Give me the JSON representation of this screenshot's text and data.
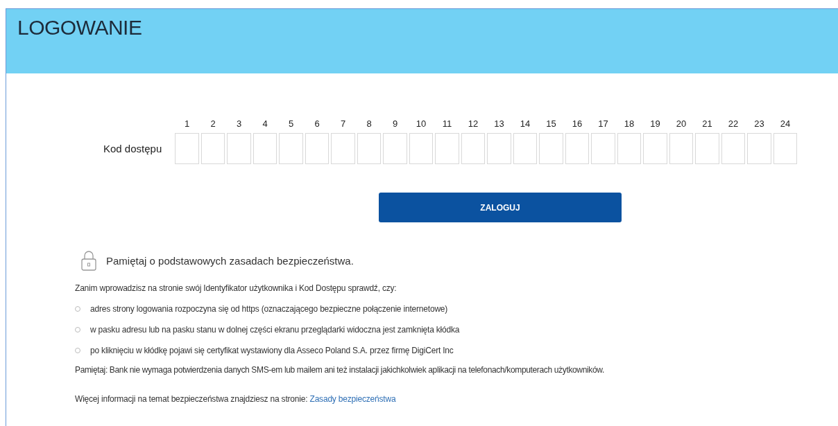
{
  "header": {
    "title": "LOGOWANIE"
  },
  "access_code": {
    "label": "Kod dostępu",
    "positions": [
      "1",
      "2",
      "3",
      "4",
      "5",
      "6",
      "7",
      "8",
      "9",
      "10",
      "11",
      "12",
      "13",
      "14",
      "15",
      "16",
      "17",
      "18",
      "19",
      "20",
      "21",
      "22",
      "23",
      "24"
    ]
  },
  "login_button": "ZALOGUJ",
  "security": {
    "heading": "Pamiętaj o podstawowych zasadach bezpieczeństwa.",
    "intro": "Zanim wprowadzisz na stronie swój Identyfikator użytkownika i Kod Dostępu sprawdź, czy:",
    "checks": [
      "adres strony logowania rozpoczyna się od https (oznaczającego bezpieczne połączenie internetowe)",
      "w pasku adresu lub na pasku stanu w dolnej części ekranu przeglądarki widoczna jest zamknięta kłódka",
      "po kliknięciu w kłódkę pojawi się certyfikat wystawiony dla Asseco Poland S.A. przez firmę DigiCert Inc"
    ],
    "reminder": "Pamiętaj: Bank nie wymaga potwierdzenia danych SMS-em lub mailem ani też instalacji jakichkolwiek aplikacji na telefonach/komputerach użytkowników.",
    "more_info": "Więcej informacji na temat bezpieczeństwa znajdziesz na stronie:",
    "more_info_link": "Zasady bezpieczeństwa"
  }
}
